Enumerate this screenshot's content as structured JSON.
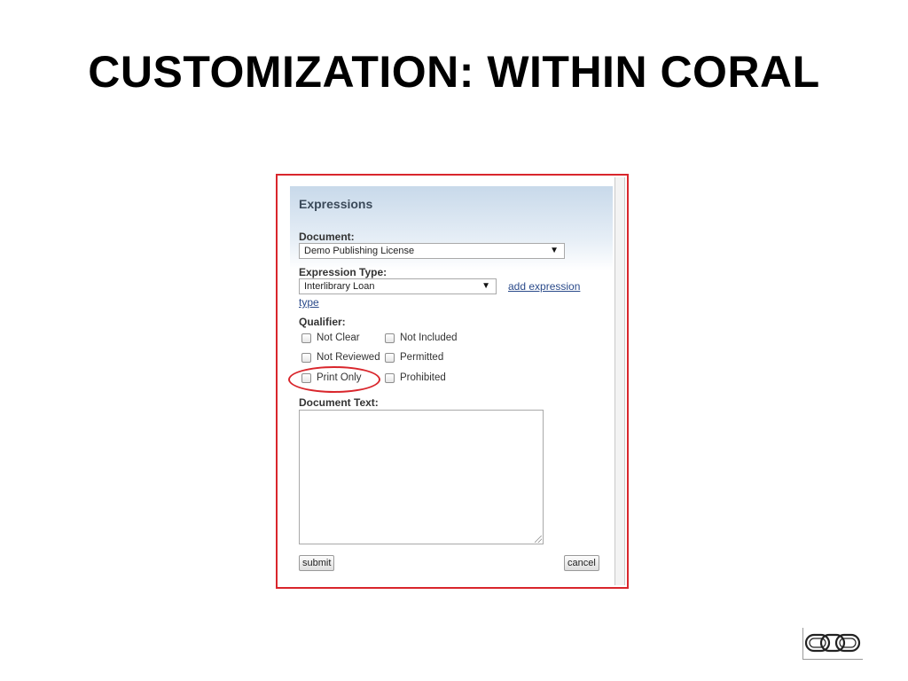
{
  "slide": {
    "title": "CUSTOMIZATION: WITHIN CORAL"
  },
  "panel": {
    "title": "Expressions",
    "document": {
      "label": "Document:",
      "selected": "Demo Publishing License"
    },
    "expression_type": {
      "label": "Expression Type:",
      "selected": "Interlibrary Loan",
      "add_link_part1": "add expression",
      "add_link_part2": "type"
    },
    "qualifier": {
      "label": "Qualifier:",
      "options": [
        "Not Clear",
        "Not Included",
        "Not Reviewed",
        "Permitted",
        "Print Only",
        "Prohibited"
      ]
    },
    "document_text": {
      "label": "Document Text:",
      "value": ""
    },
    "buttons": {
      "submit": "submit",
      "cancel": "cancel"
    }
  },
  "colors": {
    "highlight": "#d9262c",
    "link": "#2a4a8a",
    "panel_header": "#c8d9ea"
  },
  "icons": {
    "dropdown": "triangle-down",
    "logo": "chain-links-logo"
  }
}
